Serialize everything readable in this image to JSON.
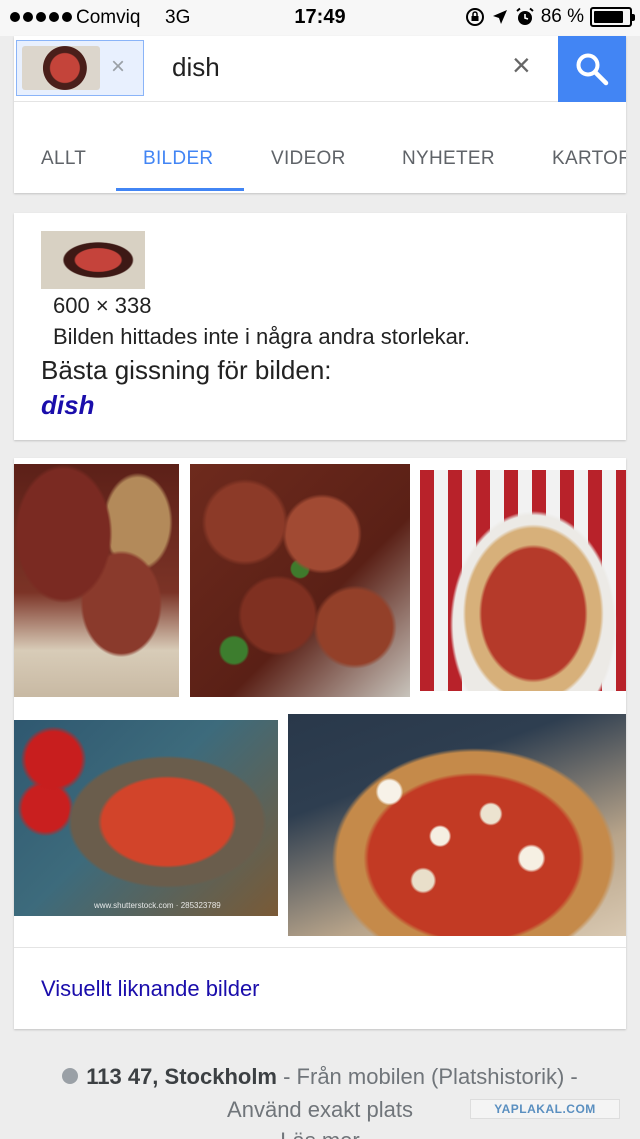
{
  "status_bar": {
    "carrier": "Comviq",
    "network": "3G",
    "time": "17:49",
    "battery": "86 %",
    "battery_level": 0.86,
    "icons": [
      "signal-dots",
      "orientation-lock-icon",
      "location-arrow-icon",
      "alarm-icon",
      "battery-icon"
    ]
  },
  "search": {
    "query": "dish",
    "chip_remove": "×",
    "clear": "×",
    "button_icon": "search-icon"
  },
  "tabs": [
    "ALLT",
    "BILDER",
    "VIDEOR",
    "NYHETER",
    "KARTOR"
  ],
  "active_tab": "BILDER",
  "result_info": {
    "dimensions": "600 × 338",
    "not_found": "Bilden hittades inte i några andra storlekar.",
    "best_guess_label": "Bästa gissning för bilden:",
    "best_guess": "dish"
  },
  "similar": {
    "link_label": "Visuellt liknande bilder",
    "watermark_text": "www.shutterstock.com · 285323789"
  },
  "footer": {
    "place": "113 47, Stockholm",
    "source": " - Från mobilen (Platshistorik) -",
    "exact_location": "Använd exakt plats",
    "cut_off": "Läs mer"
  },
  "overlay_watermark": "YAPLAKAL.COM",
  "colors": {
    "accent": "#4285f4",
    "link": "#1a0dab",
    "background": "#ededed"
  }
}
